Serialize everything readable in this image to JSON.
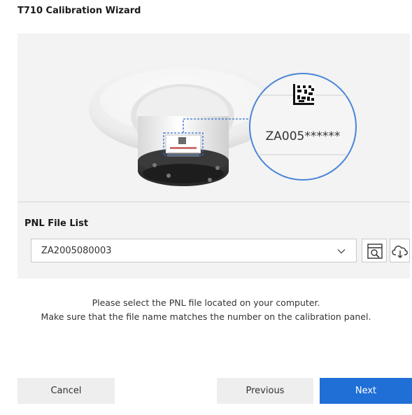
{
  "window": {
    "title": "T710 Calibration Wizard"
  },
  "illustration": {
    "serial_label": "ZA005******"
  },
  "pnl": {
    "label": "PNL File List",
    "selected_value": "ZA2005080003",
    "buttons": [
      {
        "icon": "search-file-icon"
      },
      {
        "icon": "cloud-download-icon"
      }
    ]
  },
  "instructions": {
    "line1": "Please select the PNL file located on your computer.",
    "line2": "Make sure that the file name matches the number on the calibration panel."
  },
  "actions": {
    "cancel_label": "Cancel",
    "previous_label": "Previous",
    "next_label": "Next"
  },
  "colors": {
    "accent": "#1f6fd6",
    "callout_ring": "#4a86d8",
    "panel_bg": "#f3f3f3"
  }
}
